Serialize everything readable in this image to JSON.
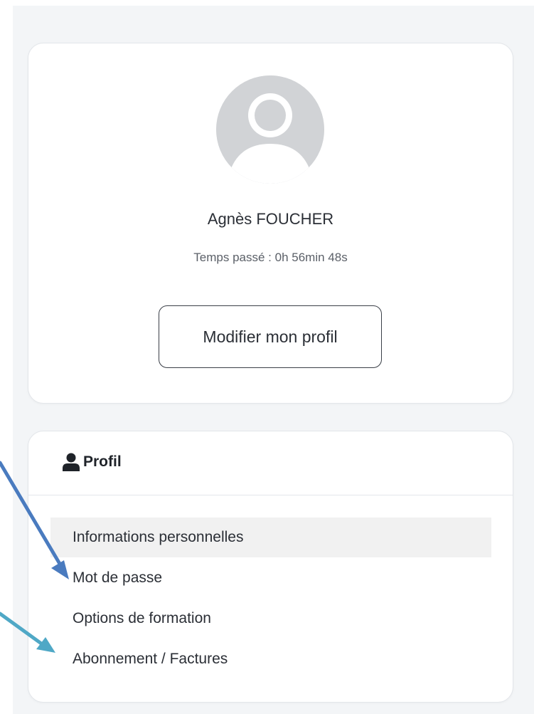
{
  "profile": {
    "name": "Agnès FOUCHER",
    "time_spent": "Temps passé : 0h 56min 48s",
    "edit_button_label": "Modifier mon profil"
  },
  "menu": {
    "title": "Profil",
    "title_icon": "person-icon",
    "items": [
      {
        "label": "Informations personnelles",
        "active": true
      },
      {
        "label": "Mot de passe",
        "active": false
      },
      {
        "label": "Options de formation",
        "active": false
      },
      {
        "label": "Abonnement / Factures",
        "active": false
      }
    ]
  },
  "colors": {
    "arrow_blue": "#4a7bbf",
    "arrow_teal": "#4fa8c6",
    "avatar_bg": "#d1d3d6",
    "active_item_bg": "#f1f1f1"
  }
}
